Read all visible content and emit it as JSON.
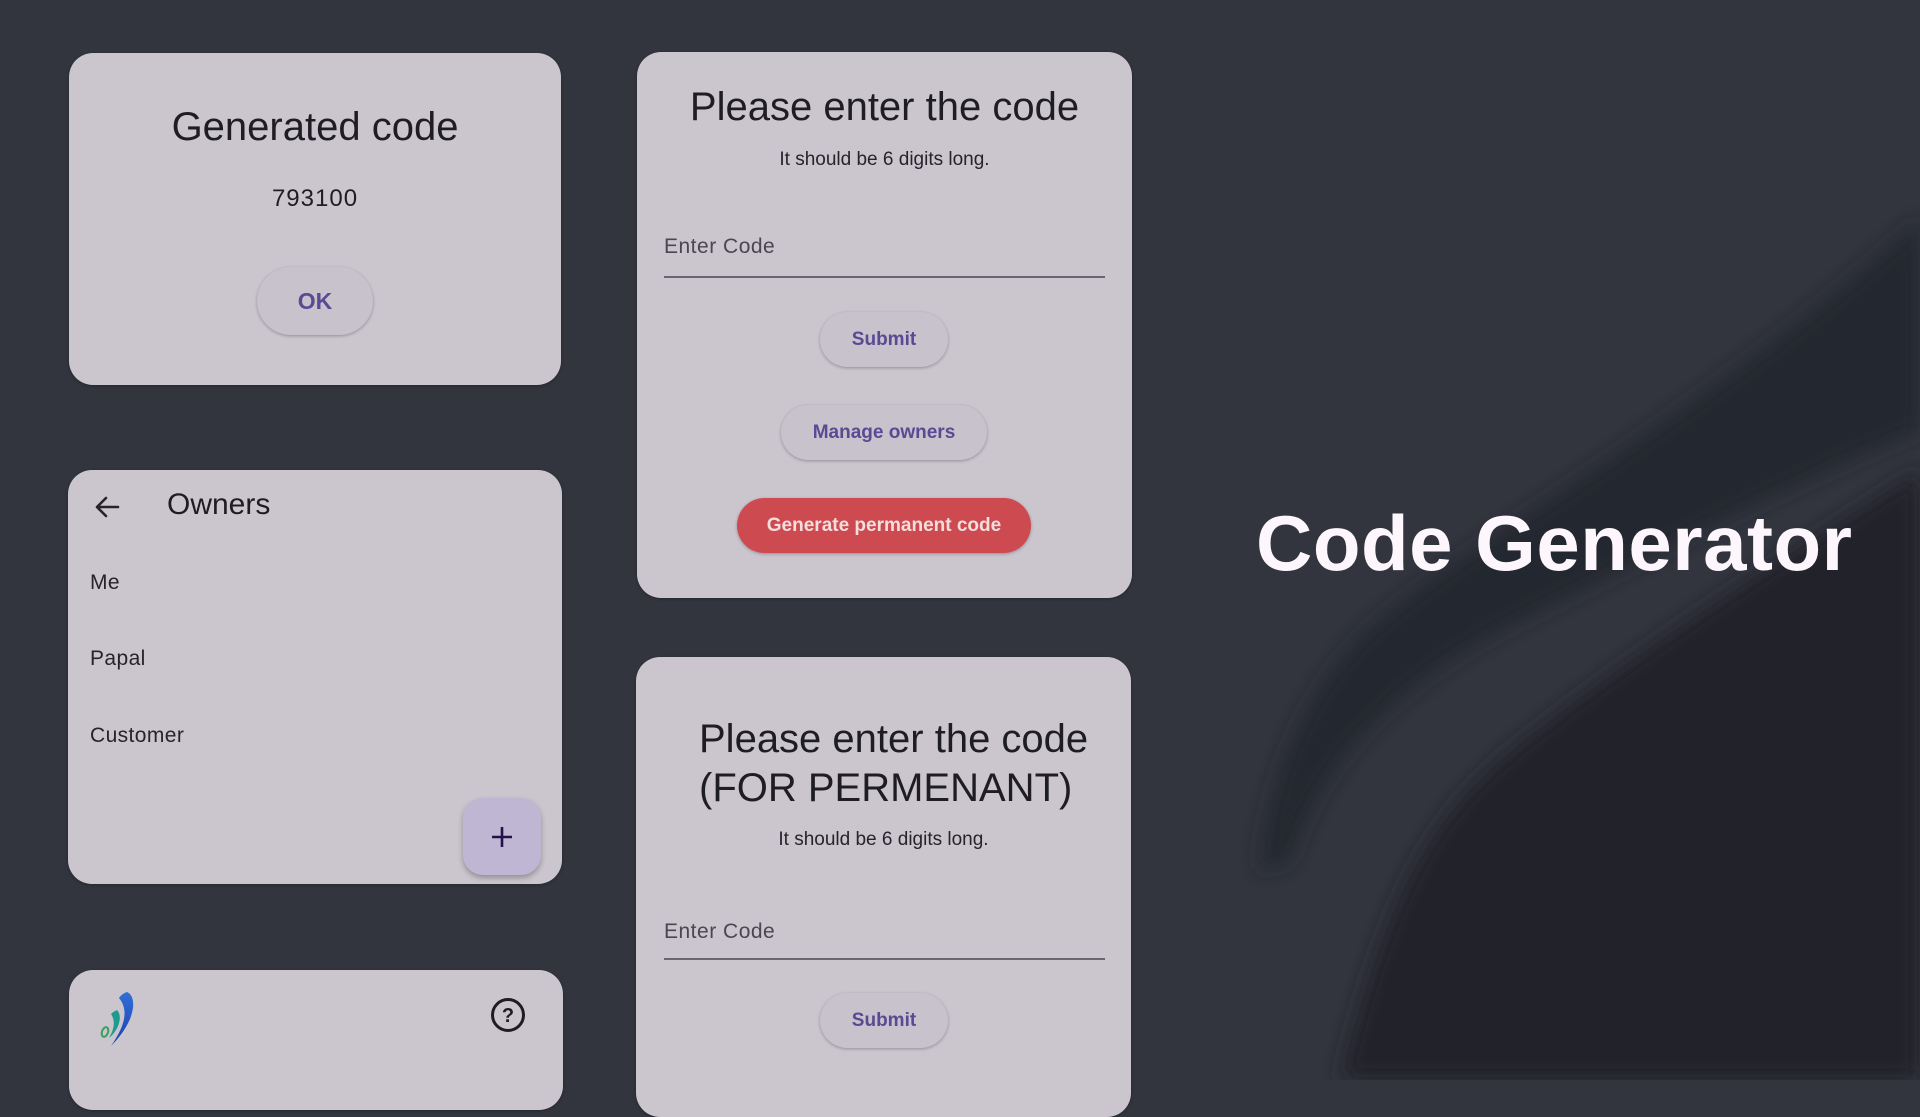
{
  "hero": {
    "title": "Code Generator"
  },
  "generated_dialog": {
    "title": "Generated code",
    "code": "793100",
    "ok_label": "OK"
  },
  "owners": {
    "title": "Owners",
    "back_icon": "arrow-left-icon",
    "items": [
      {
        "label": "Me"
      },
      {
        "label": "Papal"
      },
      {
        "label": "Customer"
      }
    ],
    "fab_icon": "plus-icon"
  },
  "home_bar": {
    "logo_icon": "app-logo-icon",
    "help_icon": "help-circle-icon"
  },
  "enter_code": {
    "title": "Please enter the code",
    "subtitle": "It should be 6 digits long.",
    "input_placeholder": "Enter Code",
    "input_value": "",
    "submit_label": "Submit",
    "manage_owners_label": "Manage owners",
    "generate_permanent_label": "Generate permanent code"
  },
  "enter_permanent_code": {
    "title_line1": "Please enter the code",
    "title_line2": "(FOR PERMENANT)",
    "subtitle": "It should be 6 digits long.",
    "input_placeholder": "Enter Code",
    "input_value": "",
    "submit_label": "Submit"
  },
  "colors": {
    "background": "#32343e",
    "card": "#cbc6ce",
    "primary_text": "#5a4a94",
    "danger": "#cd4b50",
    "fab": "#bfb6d3",
    "hero_text": "#fdf7fd"
  }
}
